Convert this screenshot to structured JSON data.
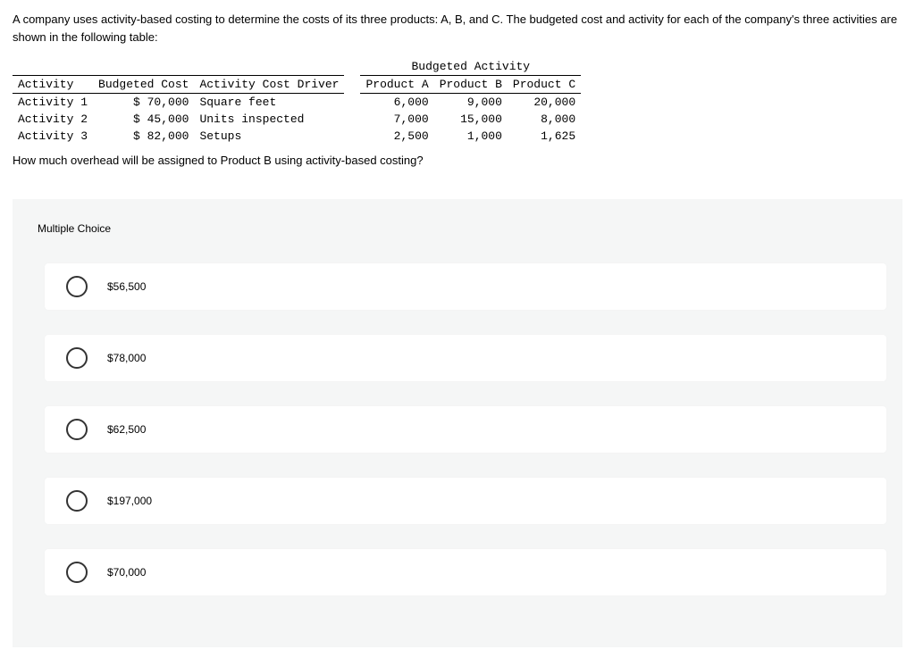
{
  "intro": "A company uses activity-based costing to determine the costs of its three products: A, B, and C. The budgeted cost and activity for each of the company's three activities are shown in the following table:",
  "table": {
    "super_header": "Budgeted Activity",
    "headers": {
      "c1": "Activity",
      "c2": "Budgeted Cost",
      "c3": "Activity Cost Driver",
      "c4": "Product A",
      "c5": "Product B",
      "c6": "Product C"
    },
    "rows": [
      {
        "activity": "Activity 1",
        "cost": "$ 70,000",
        "driver": "Square feet",
        "a": "6,000",
        "b": "9,000",
        "c": "20,000"
      },
      {
        "activity": "Activity 2",
        "cost": "$ 45,000",
        "driver": "Units inspected",
        "a": "7,000",
        "b": "15,000",
        "c": "8,000"
      },
      {
        "activity": "Activity 3",
        "cost": "$ 82,000",
        "driver": "Setups",
        "a": "2,500",
        "b": "1,000",
        "c": "1,625"
      }
    ]
  },
  "question": "How much overhead will be assigned to Product B using activity-based costing?",
  "mc_heading": "Multiple Choice",
  "choices": [
    "$56,500",
    "$78,000",
    "$62,500",
    "$197,000",
    "$70,000"
  ]
}
